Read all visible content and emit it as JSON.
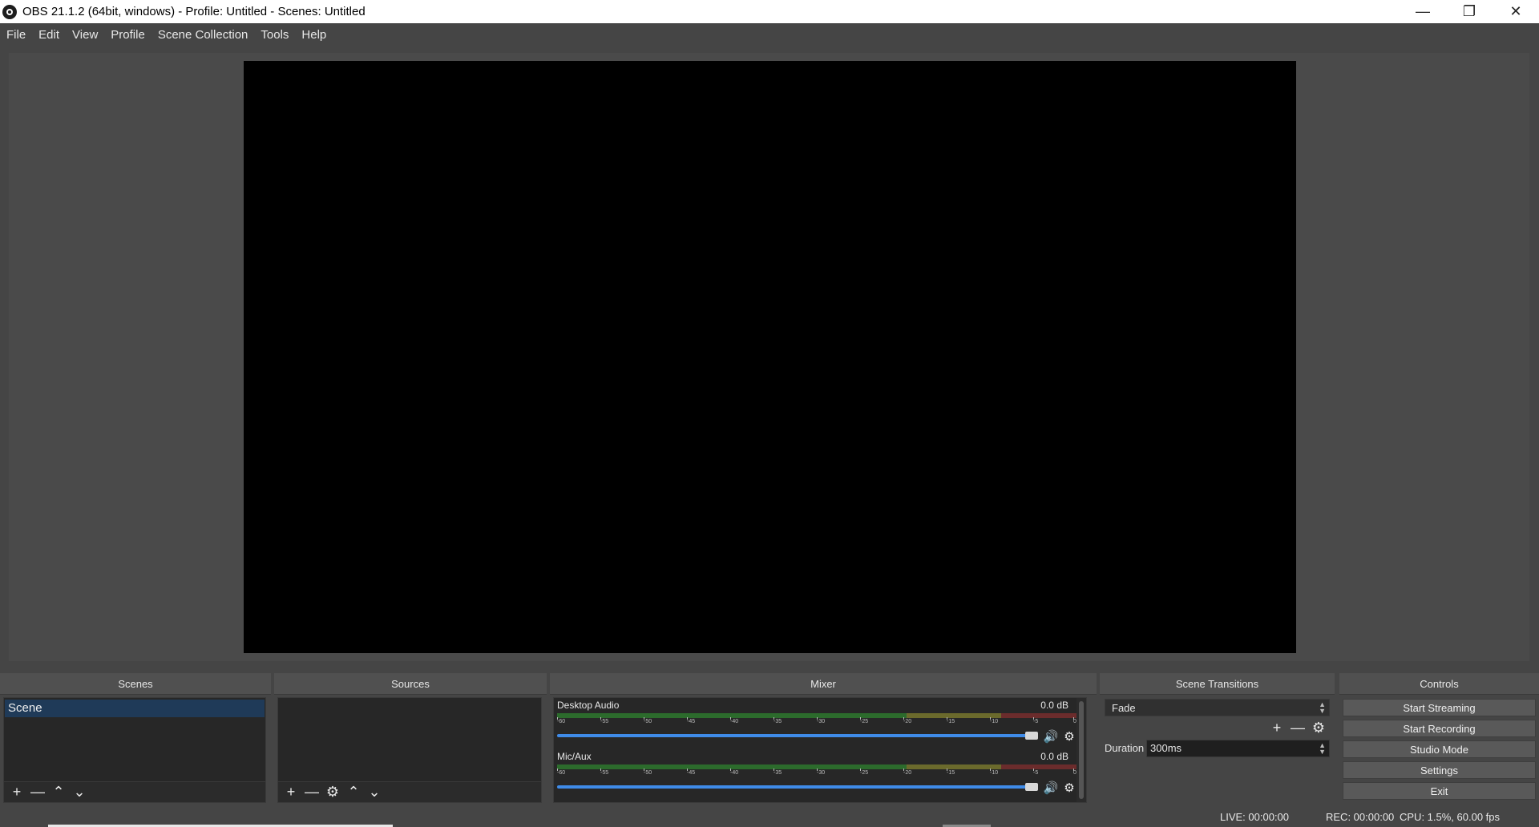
{
  "window": {
    "title": "OBS 21.1.2 (64bit, windows) - Profile: Untitled - Scenes: Untitled",
    "minimize_glyph": "—",
    "restore_glyph": "❐",
    "close_glyph": "✕"
  },
  "menu": [
    "File",
    "Edit",
    "View",
    "Profile",
    "Scene Collection",
    "Tools",
    "Help"
  ],
  "docks": {
    "scenes": {
      "title": "Scenes",
      "items": [
        "Scene"
      ]
    },
    "sources": {
      "title": "Sources"
    },
    "mixer": {
      "title": "Mixer",
      "ticks": [
        "-60",
        "-55",
        "-50",
        "-45",
        "-40",
        "-35",
        "-30",
        "-25",
        "-20",
        "-15",
        "-10",
        "-5",
        "0"
      ],
      "channels": [
        {
          "name": "Desktop Audio",
          "level": "0.0 dB",
          "volume": 1.0
        },
        {
          "name": "Mic/Aux",
          "level": "0.0 dB",
          "volume": 1.0
        }
      ]
    },
    "transitions": {
      "title": "Scene Transitions",
      "selected": "Fade",
      "duration_label": "Duration",
      "duration_value": "300ms"
    },
    "controls": {
      "title": "Controls",
      "buttons": [
        "Start Streaming",
        "Start Recording",
        "Studio Mode",
        "Settings",
        "Exit"
      ]
    }
  },
  "status": {
    "live": "LIVE: 00:00:00",
    "rec": "REC: 00:00:00",
    "cpu": "CPU: 1.5%, 60.00 fps"
  },
  "icons": {
    "add": "+",
    "remove": "—",
    "up": "⌃",
    "down": "⌄",
    "gear": "⚙",
    "speaker": "🔊"
  }
}
